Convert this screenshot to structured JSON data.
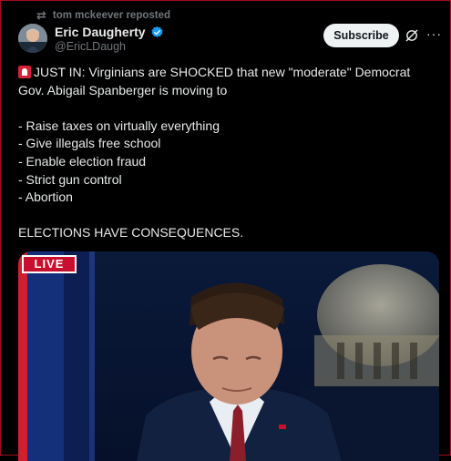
{
  "repost": {
    "text": "tom mckeever reposted",
    "icon": "repost-icon"
  },
  "author": {
    "name": "Eric Daugherty",
    "handle": "@EricLDaugh",
    "verified": true
  },
  "actions": {
    "subscribe_label": "Subscribe"
  },
  "post": {
    "headline": "JUST IN: Virginians are SHOCKED that new \"moderate\" Democrat Gov. Abigail Spanberger is moving to",
    "list": [
      "- Raise taxes on virtually everything",
      "- Give illegals free school",
      "- Enable election fraud",
      "- Strict gun control",
      "- Abortion"
    ],
    "closing": "ELECTIONS HAVE CONSEQUENCES."
  },
  "media": {
    "badge": "LIVE"
  },
  "colors": {
    "accent": "#1d9bf0",
    "live_red": "#c8102e",
    "frame": "#a10f1a"
  }
}
